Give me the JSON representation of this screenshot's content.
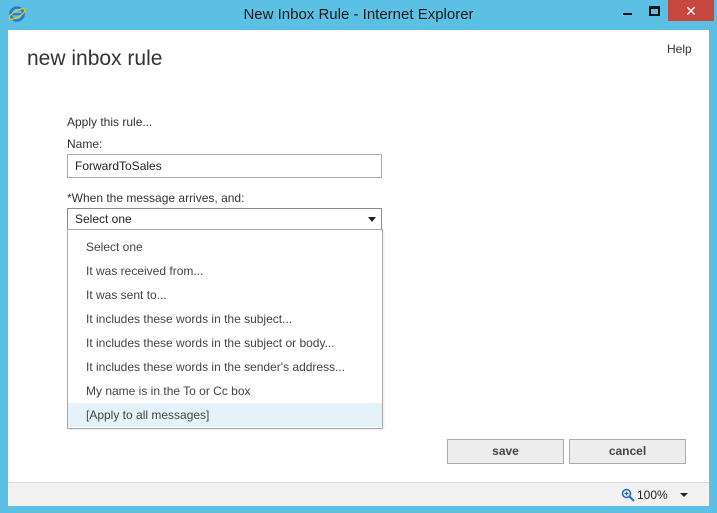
{
  "window": {
    "title": "New Inbox Rule - Internet Explorer",
    "close_glyph": "✕"
  },
  "page": {
    "help_label": "Help",
    "title": "new inbox rule"
  },
  "form": {
    "apply_label": "Apply this rule...",
    "name_label": "Name:",
    "name_value": "ForwardToSales",
    "condition_label": "*When the message arrives, and:",
    "condition_selected": "Select one",
    "condition_options": [
      "Select one",
      "It was received from...",
      "It was sent to...",
      "It includes these words in the subject...",
      "It includes these words in the subject or body...",
      "It includes these words in the sender's address...",
      "My name is in the To or Cc box",
      "[Apply to all messages]"
    ],
    "highlighted_option": "[Apply to all messages]"
  },
  "actions": {
    "save_label": "save",
    "cancel_label": "cancel"
  },
  "statusbar": {
    "zoom": "100%"
  },
  "colors": {
    "window_frame": "#5bc0e3",
    "close_button": "#c7463d",
    "highlight": "#e6f2fa"
  },
  "icons": {
    "app": "internet-explorer-icon",
    "zoom": "magnifier-icon"
  }
}
